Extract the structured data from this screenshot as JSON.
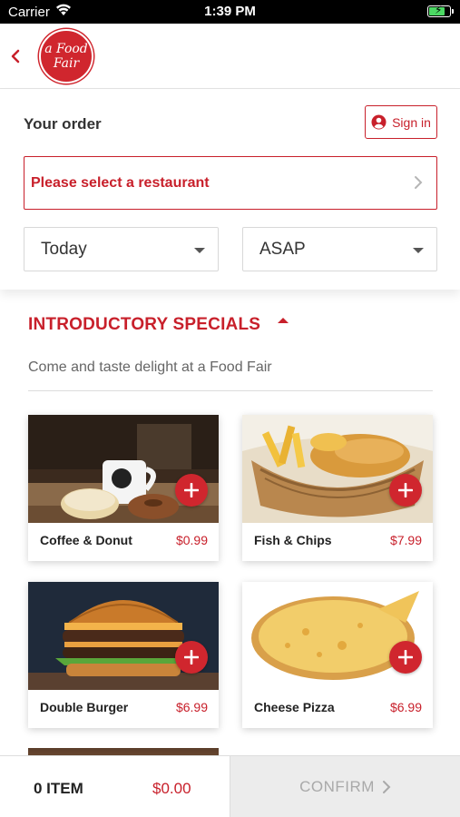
{
  "status_bar": {
    "carrier": "Carrier",
    "time": "1:39 PM",
    "battery_level": 0.8
  },
  "header": {
    "logo_line1": "a Food",
    "logo_line2": "Fair"
  },
  "order": {
    "title": "Your order",
    "sign_in_label": "Sign in",
    "restaurant_prompt": "Please select a restaurant",
    "day_value": "Today",
    "time_value": "ASAP"
  },
  "section": {
    "title": "INTRODUCTORY SPECIALS",
    "subtitle": "Come and taste delight at a Food Fair"
  },
  "menu_items": [
    {
      "name": "Coffee & Donut",
      "price": "$0.99"
    },
    {
      "name": "Fish & Chips",
      "price": "$7.99"
    },
    {
      "name": "Double Burger",
      "price": "$6.99"
    },
    {
      "name": "Cheese Pizza",
      "price": "$6.99"
    }
  ],
  "cart": {
    "item_count": "0 ITEM",
    "total": "$0.00",
    "confirm_label": "CONFIRM"
  },
  "colors": {
    "brand_red": "#c8202b",
    "confirm_disabled_bg": "#ececec"
  },
  "icons": [
    "wifi-icon",
    "battery-icon",
    "back-chevron-icon",
    "user-circle-icon",
    "chevron-right-icon",
    "caret-down-icon",
    "caret-up-icon",
    "plus-icon"
  ]
}
